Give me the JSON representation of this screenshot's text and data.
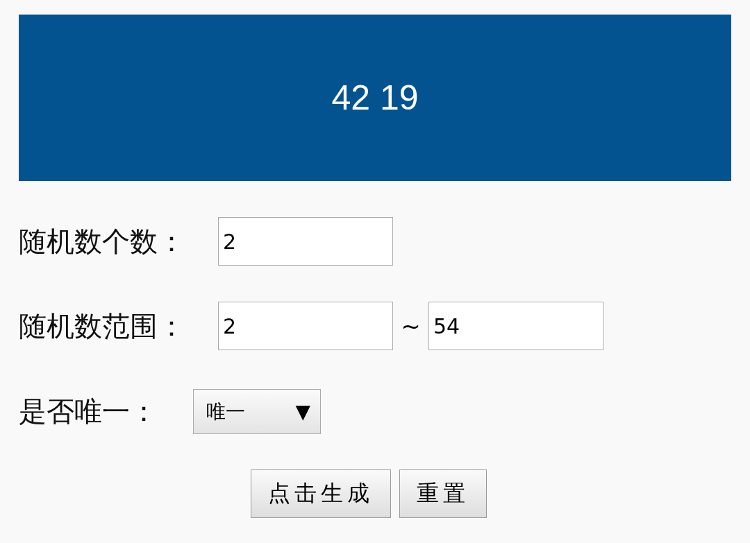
{
  "result": "42 19",
  "count": {
    "label": "随机数个数：",
    "value": "2"
  },
  "range": {
    "label": "随机数范围：",
    "min": "2",
    "separator": "~",
    "max": "54"
  },
  "unique": {
    "label": "是否唯一：",
    "value": "唯一",
    "arrow": "▼"
  },
  "buttons": [
    {
      "label": "点击生成"
    },
    {
      "label": "重置"
    }
  ]
}
